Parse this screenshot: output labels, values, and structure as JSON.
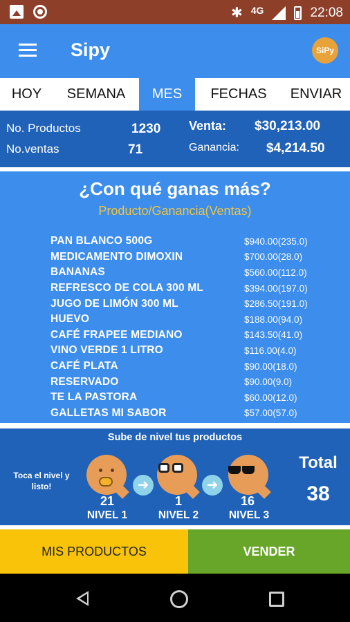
{
  "status_bar": {
    "network": "4G",
    "time": "22:08",
    "icons": [
      "image-icon",
      "record-icon",
      "bluetooth-icon",
      "signal-icon",
      "battery-icon"
    ]
  },
  "app_bar": {
    "title": "Sipy",
    "logo_text": "SiPy"
  },
  "tabs": [
    {
      "label": "HOY",
      "active": false
    },
    {
      "label": "SEMANA",
      "active": false
    },
    {
      "label": "MES",
      "active": true
    },
    {
      "label": "FECHAS",
      "active": false
    },
    {
      "label": "ENVIAR",
      "active": false
    }
  ],
  "summary": {
    "products_label": "No. Productos",
    "products_value": "1230",
    "sales_label": "No.ventas",
    "sales_value": "71",
    "revenue_label": "Venta:",
    "revenue_value": "$30,213.00",
    "profit_label": "Ganancia:",
    "profit_value": "$4,214.50"
  },
  "ranking": {
    "question": "¿Con qué ganas más?",
    "subtitle": "Producto/Ganancia(Ventas)",
    "items": [
      {
        "name": "PAN BLANCO 500G",
        "value": "$940.00(235.0)"
      },
      {
        "name": "MEDICAMENTO DIMOXIN",
        "value": "$700.00(28.0)"
      },
      {
        "name": "BANANAS",
        "value": "$560.00(112.0)"
      },
      {
        "name": "REFRESCO DE COLA 300 ML",
        "value": "$394.00(197.0)"
      },
      {
        "name": "JUGO DE LIMÓN 300 ML",
        "value": "$286.50(191.0)"
      },
      {
        "name": "HUEVO",
        "value": "$188.00(94.0)"
      },
      {
        "name": "CAFÉ FRAPEE MEDIANO",
        "value": "$143.50(41.0)"
      },
      {
        "name": "VINO VERDE 1 LITRO",
        "value": "$116.00(4.0)"
      },
      {
        "name": "CAFÉ PLATA",
        "value": "$90.00(18.0)"
      },
      {
        "name": "RESERVADO",
        "value": "$90.00(9.0)"
      },
      {
        "name": "TE LA PASTORA",
        "value": "$60.00(12.0)"
      },
      {
        "name": "GALLETAS MI SABOR",
        "value": "$57.00(57.0)"
      }
    ]
  },
  "levels": {
    "title": "Sube de nivel tus productos",
    "tap_hint": "Toca el nivel y listo!",
    "items": [
      {
        "count": "21",
        "label": "NIVEL 1"
      },
      {
        "count": "1",
        "label": "NIVEL 2"
      },
      {
        "count": "16",
        "label": "NIVEL 3"
      }
    ],
    "total_label": "Total",
    "total_value": "38"
  },
  "buttons": {
    "products": "MIS PRODUCTOS",
    "sell": "VENDER"
  },
  "colors": {
    "status_bar": "#8d3f2a",
    "primary": "#3c8dec",
    "dark_blue": "#1f62b8",
    "accent_yellow": "#f9c30a",
    "accent_green": "#68a62a",
    "subtitle_gold": "#f2c53d"
  }
}
